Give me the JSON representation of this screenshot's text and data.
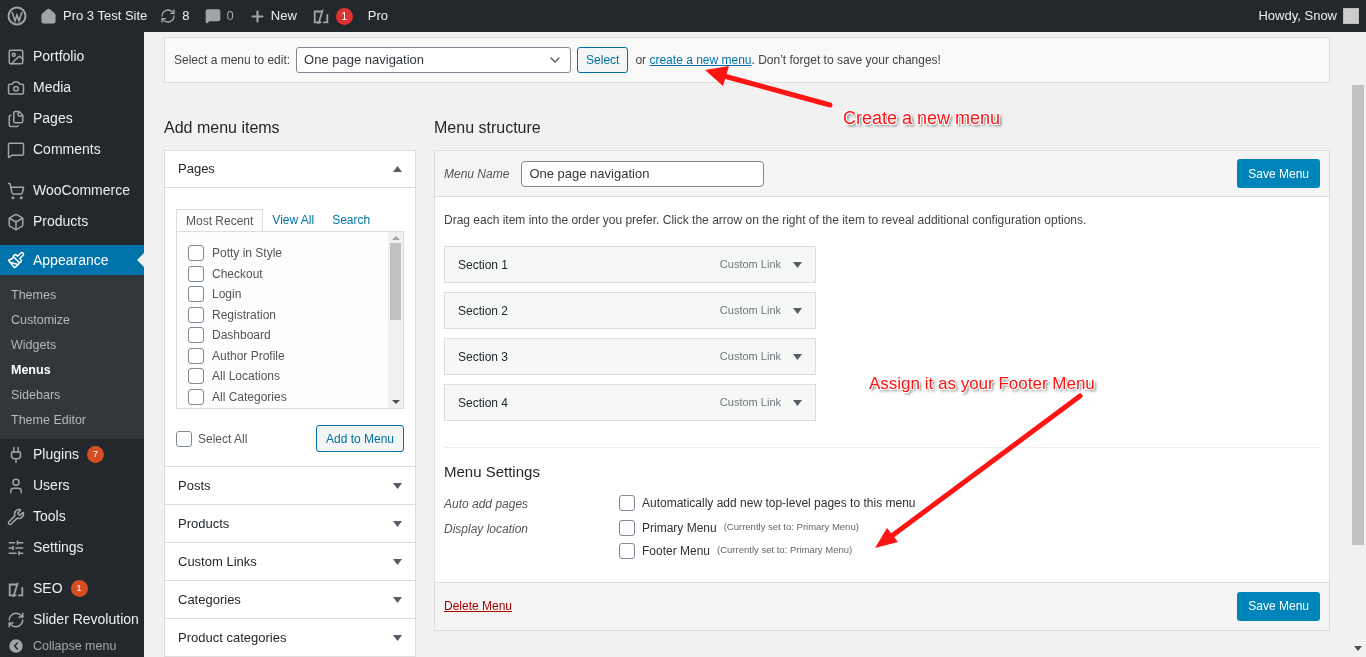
{
  "admin_bar": {
    "site": "Pro 3 Test Site",
    "updates": "8",
    "comments": "0",
    "new": "New",
    "seo_badge": "1",
    "pro": "Pro",
    "greeting": "Howdy, Snow"
  },
  "sidebar": {
    "groups": [
      {
        "items": [
          {
            "label": "Portfolio",
            "selected": false
          },
          {
            "label": "Media",
            "selected": false
          },
          {
            "label": "Pages",
            "selected": false
          },
          {
            "label": "Comments",
            "selected": false
          }
        ]
      },
      {
        "items": [
          {
            "label": "WooCommerce",
            "selected": false
          },
          {
            "label": "Products",
            "selected": false
          },
          {
            "label": "Appearance",
            "selected": true,
            "children": [
              {
                "label": "Themes",
                "selected": false
              },
              {
                "label": "Customize",
                "selected": false
              },
              {
                "label": "Widgets",
                "selected": false
              },
              {
                "label": "Menus",
                "selected": true
              },
              {
                "label": "Sidebars",
                "selected": false
              },
              {
                "label": "Theme Editor",
                "selected": false
              }
            ]
          },
          {
            "label": "Plugins",
            "selected": false,
            "badge": "7"
          },
          {
            "label": "Users",
            "selected": false
          },
          {
            "label": "Tools",
            "selected": false
          },
          {
            "label": "Settings",
            "selected": false
          }
        ]
      },
      {
        "items": [
          {
            "label": "SEO",
            "selected": false,
            "badge": "1"
          },
          {
            "label": "Slider Revolution",
            "selected": false
          }
        ]
      }
    ],
    "collapse": "Collapse menu"
  },
  "menu_select": {
    "label": "Select a menu to edit:",
    "value": "One page navigation",
    "button": "Select",
    "text_before": "or",
    "link": "create a new menu",
    "text_after": ". Don’t forget to save your changes!"
  },
  "add_items": {
    "title": "Add menu items",
    "sections": [
      {
        "title": "Pages",
        "expanded": true,
        "tabs": [
          {
            "label": "Most Recent",
            "selected": true
          },
          {
            "label": "View All",
            "selected": false
          },
          {
            "label": "Search",
            "selected": false
          }
        ],
        "items": [
          {
            "label": "Potty in Style",
            "checked": false
          },
          {
            "label": "Checkout",
            "checked": false
          },
          {
            "label": "Login",
            "checked": false
          },
          {
            "label": "Registration",
            "checked": false
          },
          {
            "label": "Dashboard",
            "checked": false
          },
          {
            "label": "Author Profile",
            "checked": false
          },
          {
            "label": "All Locations",
            "checked": false
          },
          {
            "label": "All Categories",
            "checked": false
          }
        ],
        "select_all": {
          "label": "Select All",
          "checked": false
        },
        "button": "Add to Menu"
      },
      {
        "title": "Posts",
        "expanded": false
      },
      {
        "title": "Products",
        "expanded": false
      },
      {
        "title": "Custom Links",
        "expanded": false
      },
      {
        "title": "Categories",
        "expanded": false
      },
      {
        "title": "Product categories",
        "expanded": false
      }
    ]
  },
  "menu_structure": {
    "title": "Menu structure",
    "name_label": "Menu Name",
    "name_value": "One page navigation",
    "save": "Save Menu",
    "instructions": "Drag each item into the order you prefer. Click the arrow on the right of the item to reveal additional configuration options.",
    "items": [
      {
        "title": "Section 1",
        "type": "Custom Link"
      },
      {
        "title": "Section 2",
        "type": "Custom Link"
      },
      {
        "title": "Section 3",
        "type": "Custom Link"
      },
      {
        "title": "Section 4",
        "type": "Custom Link"
      }
    ],
    "settings": {
      "title": "Menu Settings",
      "rows": [
        {
          "label": "Auto add pages",
          "options": [
            {
              "label": "Automatically add new top-level pages to this menu",
              "checked": false
            }
          ]
        },
        {
          "label": "Display location",
          "options": [
            {
              "label": "Primary Menu",
              "note": "(Currently set to: Primary Menu)",
              "checked": false
            },
            {
              "label": "Footer Menu",
              "note": "(Currently set to: Primary Menu)",
              "checked": false
            }
          ]
        }
      ]
    },
    "delete": "Delete Menu",
    "save_bottom": "Save Menu"
  },
  "annotations": [
    {
      "text": "Create a new menu"
    },
    {
      "text": "Assign it as your Footer Menu"
    }
  ]
}
